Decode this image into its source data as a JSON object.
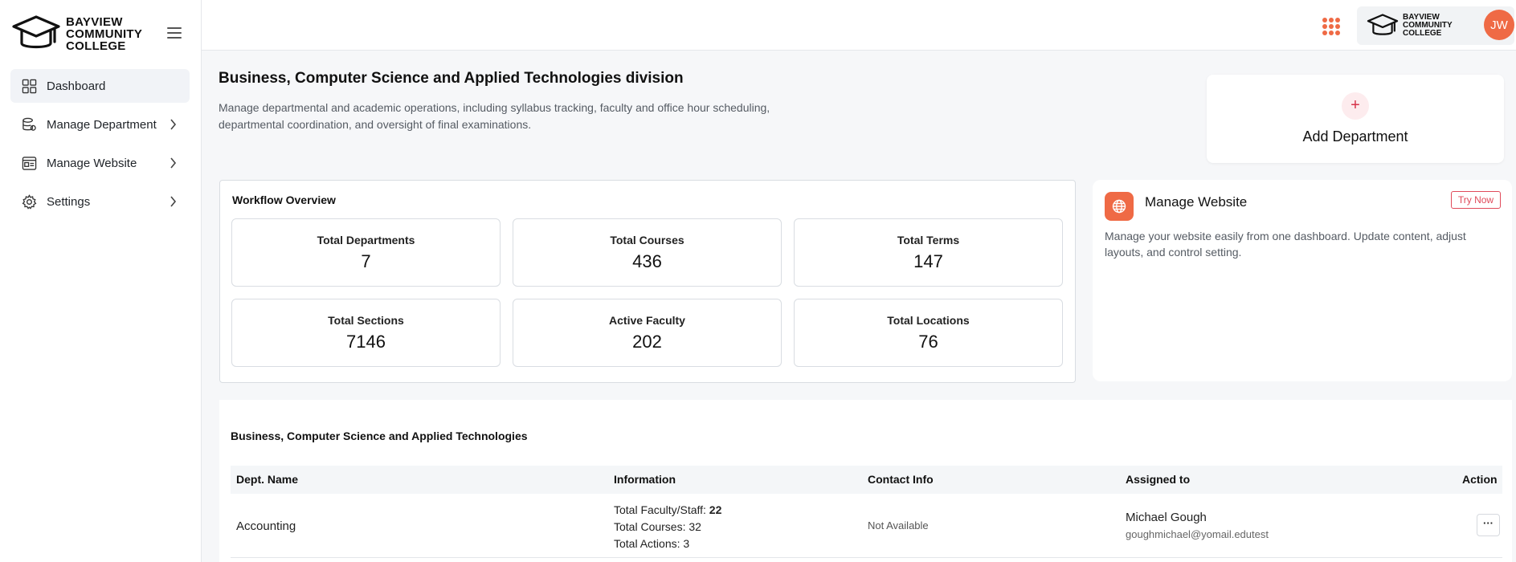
{
  "brand": {
    "line1": "BAYVIEW",
    "line2": "COMMUNITY",
    "line3": "COLLEGE"
  },
  "sidebar": {
    "items": [
      {
        "label": "Dashboard",
        "icon": "dashboard-grid-icon",
        "active": true
      },
      {
        "label": "Manage Department",
        "icon": "database-gear-icon"
      },
      {
        "label": "Manage Website",
        "icon": "browser-window-icon"
      },
      {
        "label": "Settings",
        "icon": "gear-icon"
      }
    ]
  },
  "topbar": {
    "avatar_initials": "JW"
  },
  "header": {
    "title": "Business, Computer Science and Applied Technologies division",
    "description": "Manage departmental and academic operations, including syllabus tracking, faculty and office hour scheduling, departmental coordination, and oversight of final examinations."
  },
  "add_department": {
    "plus": "+",
    "label": "Add Department"
  },
  "workflow": {
    "title": "Workflow Overview",
    "stats": [
      {
        "label": "Total Departments",
        "value": "7"
      },
      {
        "label": "Total Courses",
        "value": "436"
      },
      {
        "label": "Total Terms",
        "value": "147"
      },
      {
        "label": "Total Sections",
        "value": "7146"
      },
      {
        "label": "Active Faculty",
        "value": "202"
      },
      {
        "label": "Total Locations",
        "value": "76"
      }
    ]
  },
  "manage_website": {
    "title": "Manage Website",
    "try_label": "Try Now",
    "description": "Manage your website easily from one dashboard. Update content, adjust layouts, and control setting."
  },
  "departments": {
    "title": "Business, Computer Science and Applied Technologies",
    "columns": [
      "Dept. Name",
      "Information",
      "Contact Info",
      "Assigned to",
      "Action"
    ],
    "rows": [
      {
        "name": "Accounting",
        "faculty_label": "Total Faculty/Staff:",
        "faculty_value": "22",
        "courses": "Total Courses: 32",
        "actions": "Total Actions: 3",
        "contact": "Not Available",
        "assignee_name": "Michael Gough",
        "assignee_email": "goughmichael@yomail.edutest",
        "action_label": "···"
      }
    ]
  },
  "colors": {
    "accent": "#ef6a45",
    "danger": "#e04a5a"
  }
}
